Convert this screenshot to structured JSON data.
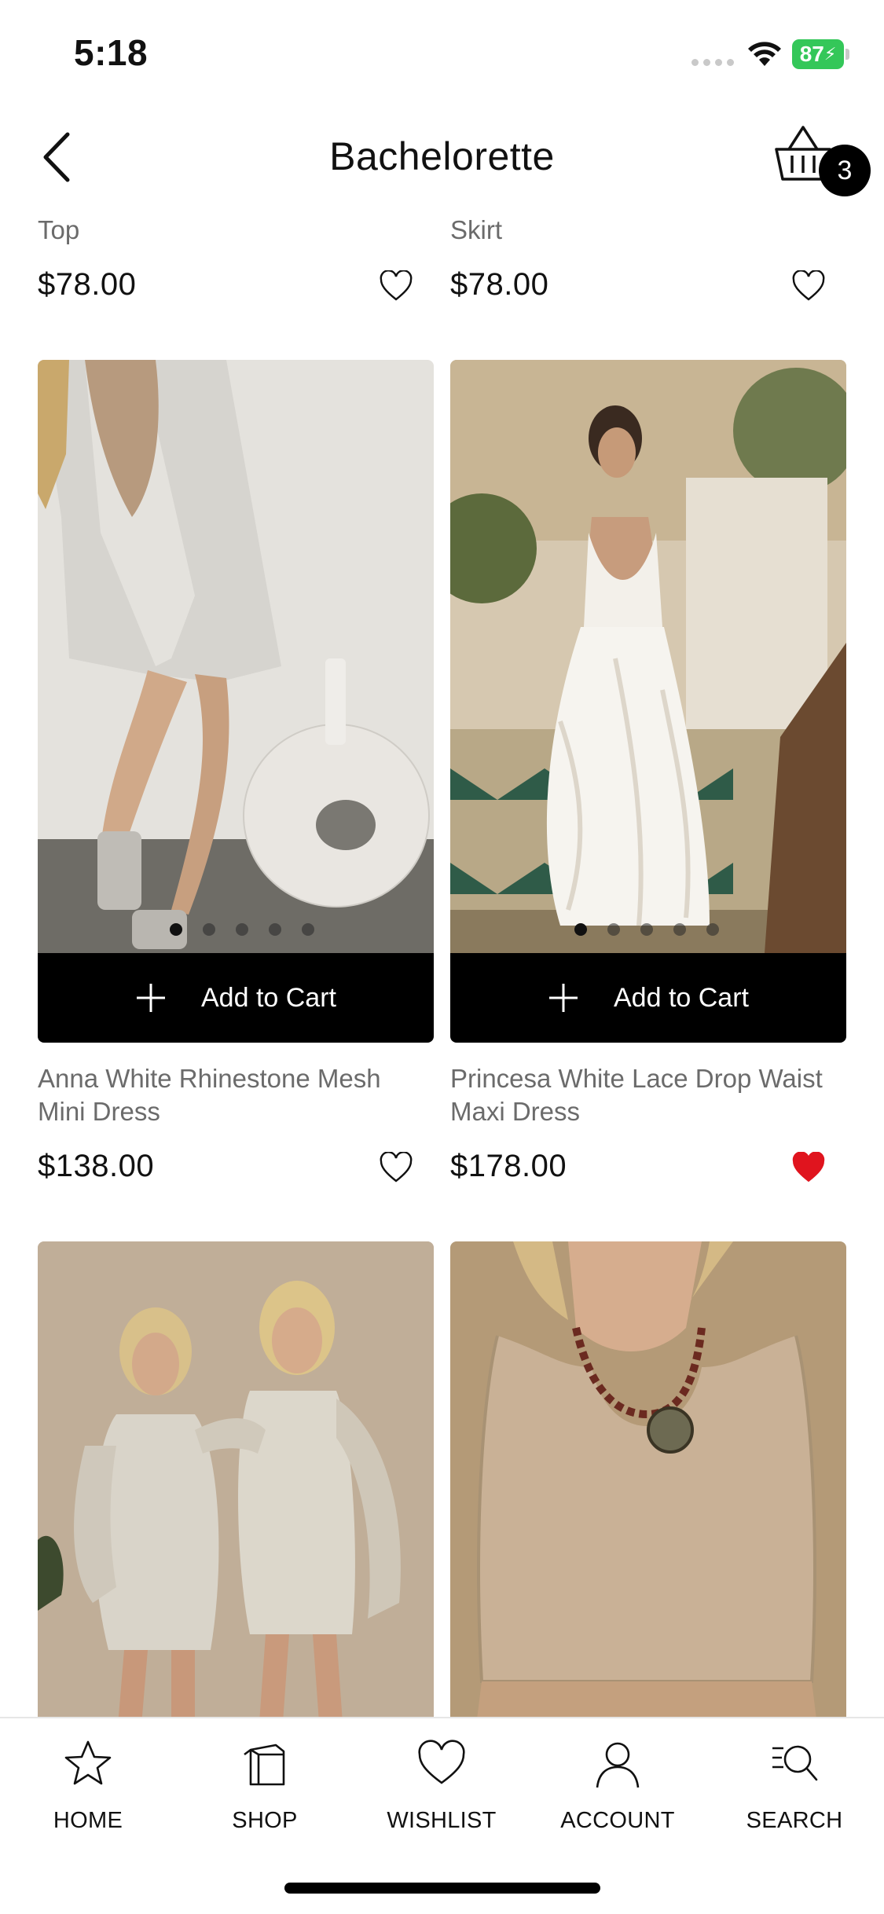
{
  "status_bar": {
    "time": "5:18",
    "battery": "87"
  },
  "header": {
    "title": "Bachelorette",
    "cart_count": "3"
  },
  "products_top": [
    {
      "name_visible": "Top",
      "price": "$78.00",
      "favorited": false
    },
    {
      "name_visible": "Skirt",
      "price": "$78.00",
      "favorited": false
    }
  ],
  "products": [
    {
      "name": "Anna White Rhinestone Mesh Mini Dress",
      "price": "$138.00",
      "favorited": false,
      "image_count": 5,
      "active_image": 0
    },
    {
      "name": "Princesa White Lace Drop Waist Maxi Dress",
      "price": "$178.00",
      "favorited": true,
      "image_count": 5,
      "active_image": 0
    }
  ],
  "add_to_cart_label": "Add to Cart",
  "tabs": [
    {
      "label": "HOME",
      "icon": "star-icon"
    },
    {
      "label": "SHOP",
      "icon": "shopping-bag-icon"
    },
    {
      "label": "WISHLIST",
      "icon": "heart-icon"
    },
    {
      "label": "ACCOUNT",
      "icon": "user-icon"
    },
    {
      "label": "SEARCH",
      "icon": "search-icon"
    }
  ],
  "colors": {
    "accent": "#000000",
    "favorite_heart": "#e0141e",
    "battery": "#34c759"
  }
}
